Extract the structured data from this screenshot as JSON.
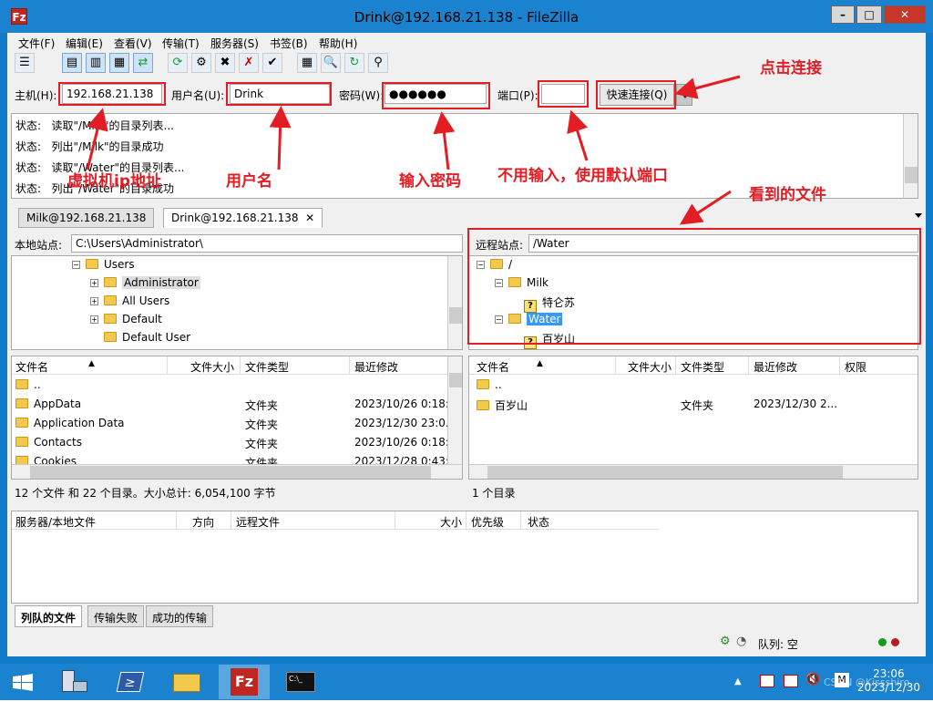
{
  "window": {
    "title": "Drink@192.168.21.138 - FileZilla",
    "app_icon": "Fz"
  },
  "menu": [
    "文件(F)",
    "编辑(E)",
    "查看(V)",
    "传输(T)",
    "服务器(S)",
    "书签(B)",
    "帮助(H)"
  ],
  "quickconnect": {
    "host_label": "主机(H):",
    "host_value": "192.168.21.138",
    "user_label": "用户名(U):",
    "user_value": "Drink",
    "pass_label": "密码(W):",
    "pass_value": "●●●●●●",
    "port_label": "端口(P):",
    "port_value": "",
    "button": "快速连接(Q)"
  },
  "log": [
    {
      "label": "状态:",
      "text": "读取\"/Milk\"的目录列表..."
    },
    {
      "label": "状态:",
      "text": "列出\"/Milk\"的目录成功"
    },
    {
      "label": "状态:",
      "text": "读取\"/Water\"的目录列表..."
    },
    {
      "label": "状态:",
      "text": "列出\"/Water\"的目录成功"
    }
  ],
  "tabs": [
    "Milk@192.168.21.138",
    "Drink@192.168.21.138"
  ],
  "local": {
    "site_label": "本地站点:",
    "path": "C:\\Users\\Administrator\\",
    "tree": [
      "Users",
      "Administrator",
      "All Users",
      "Default",
      "Default User"
    ],
    "headers": [
      "文件名",
      "文件大小",
      "文件类型",
      "最近修改"
    ],
    "files": [
      {
        "name": "..",
        "type": "",
        "modified": ""
      },
      {
        "name": "AppData",
        "type": "文件夹",
        "modified": "2023/10/26 0:18:.."
      },
      {
        "name": "Application Data",
        "type": "文件夹",
        "modified": "2023/12/30 23:0.."
      },
      {
        "name": "Contacts",
        "type": "文件夹",
        "modified": "2023/10/26 0:18:.."
      },
      {
        "name": "Cookies",
        "type": "文件夹",
        "modified": "2023/12/28 0:43:.."
      }
    ],
    "status": "12 个文件 和 22 个目录。大小总计: 6,054,100 字节"
  },
  "remote": {
    "site_label": "远程站点:",
    "path": "/Water",
    "tree": [
      "/",
      "Milk",
      "特仑苏",
      "Water",
      "百岁山"
    ],
    "headers": [
      "文件名",
      "文件大小",
      "文件类型",
      "最近修改",
      "权限"
    ],
    "files": [
      {
        "name": "..",
        "type": "",
        "modified": ""
      },
      {
        "name": "百岁山",
        "type": "文件夹",
        "modified": "2023/12/30 2..."
      }
    ],
    "status": "1 个目录"
  },
  "queue": {
    "headers": [
      "服务器/本地文件",
      "方向",
      "远程文件",
      "大小",
      "优先级",
      "状态"
    ],
    "tabs": [
      "列队的文件",
      "传输失败",
      "成功的传输"
    ],
    "status": "队列: 空"
  },
  "annotations": {
    "host": "虚拟机ip地址",
    "user": "用户名",
    "pass": "输入密码",
    "port": "不用输入，使用默认端口",
    "connect": "点击连接",
    "files": "看到的文件"
  },
  "taskbar": {
    "time": "23:06",
    "date": "2023/12/30",
    "watermark": "CSDN @Kissshiro"
  },
  "colors": {
    "accent": "#1b82d0",
    "annotation": "#e21d24",
    "selection": "#3399ff"
  }
}
